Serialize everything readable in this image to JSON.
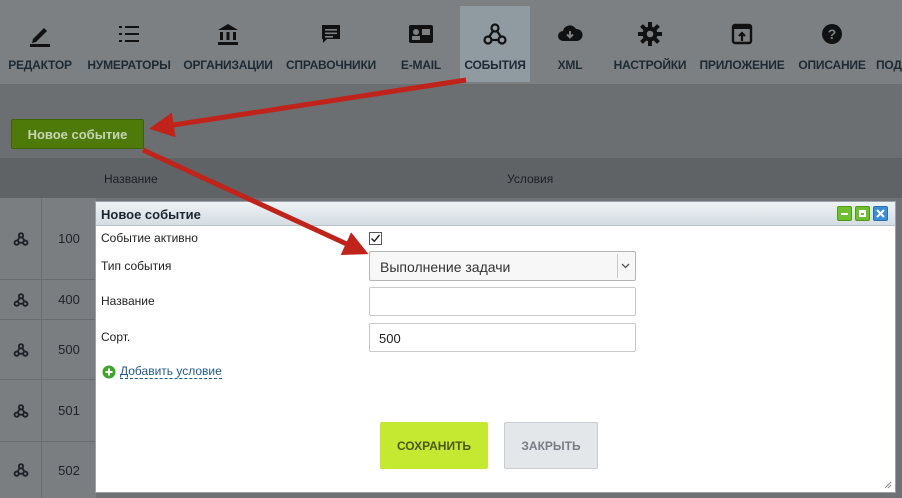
{
  "toolbar": {
    "items": [
      {
        "label": "РЕДАКТОР",
        "icon": "pencil-icon"
      },
      {
        "label": "НУМЕРАТОРЫ",
        "icon": "list-numbered-icon"
      },
      {
        "label": "ОРГАНИЗАЦИИ",
        "icon": "bank-icon"
      },
      {
        "label": "СПРАВОЧНИКИ",
        "icon": "comment-icon"
      },
      {
        "label": "E-MAIL",
        "icon": "contact-card-icon"
      },
      {
        "label": "СОБЫТИЯ",
        "icon": "webhook-icon"
      },
      {
        "label": "XML",
        "icon": "cloud-download-icon"
      },
      {
        "label": "НАСТРОЙКИ",
        "icon": "gear-icon"
      },
      {
        "label": "ПРИЛОЖЕНИЕ",
        "icon": "open-in-app-icon"
      },
      {
        "label": "ОПИСАНИЕ",
        "icon": "help-icon"
      },
      {
        "label": "ПОД",
        "icon": ""
      }
    ],
    "active": "СОБЫТИЯ"
  },
  "new_event_button": "Новое событие",
  "table": {
    "columns": [
      "Название",
      "Условия"
    ],
    "rows": [
      {
        "sort": "100"
      },
      {
        "sort": "400"
      },
      {
        "sort": "500"
      },
      {
        "sort": "501"
      },
      {
        "sort": "502"
      }
    ]
  },
  "dialog": {
    "title": "Новое событие",
    "fields": {
      "active_label": "Событие активно",
      "active_checked": true,
      "type_label": "Тип события",
      "type_value": "Выполнение задачи",
      "name_label": "Название",
      "name_value": "",
      "sort_label": "Сорт.",
      "sort_value": "500"
    },
    "add_condition": "Добавить условие",
    "save": "СОХРАНИТЬ",
    "close": "ЗАКРЫТЬ"
  },
  "colors": {
    "annotation_arrow": "#c0231a",
    "save_button": "#c5e830",
    "new_event_button": "#4e7a09"
  }
}
